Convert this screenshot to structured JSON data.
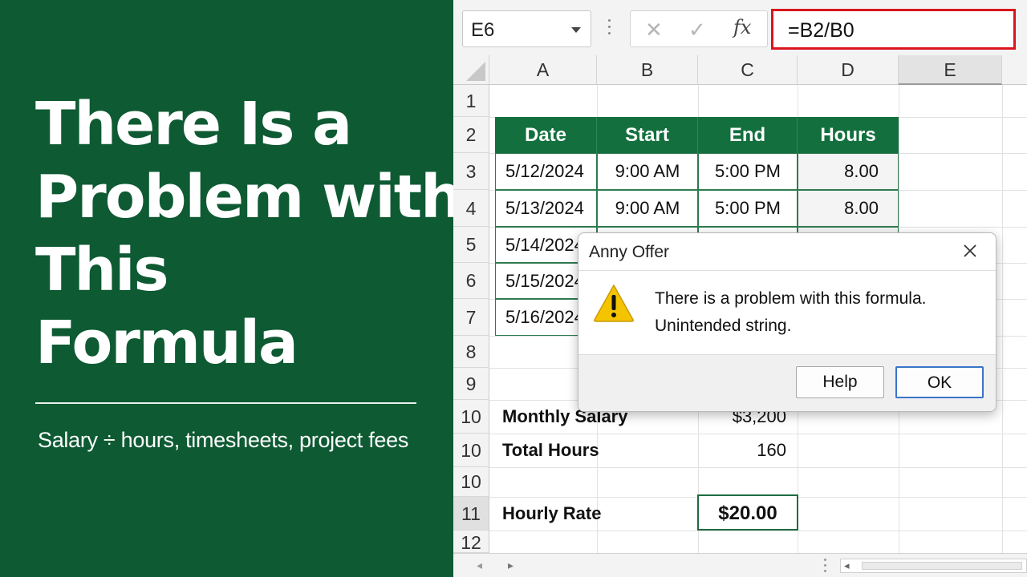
{
  "banner": {
    "title_lines": [
      "There Is a",
      "Problem with",
      "This",
      "Formula"
    ],
    "subtitle": "Salary ÷ hours, timesheets, project fees"
  },
  "formula_bar": {
    "name_box": "E6",
    "cancel_icon": "✕",
    "enter_icon": "✓",
    "fx_label": "fx",
    "formula": "=B2/B0"
  },
  "columns": [
    "A",
    "B",
    "C",
    "D",
    "E"
  ],
  "active_column": "E",
  "rows": [
    "1",
    "2",
    "3",
    "4",
    "5",
    "6",
    "7",
    "8",
    "9",
    "10",
    "10",
    "10",
    "11",
    "12"
  ],
  "active_row": "11",
  "table": {
    "headers": [
      "Date",
      "Start",
      "End",
      "Hours"
    ],
    "rows": [
      [
        "5/12/2024",
        "9:00 AM",
        "5:00 PM",
        "8.00"
      ],
      [
        "5/13/2024",
        "9:00 AM",
        "5:00 PM",
        "8.00"
      ],
      [
        "5/14/2024",
        "",
        "",
        ""
      ],
      [
        "5/15/2024",
        "",
        "",
        ""
      ],
      [
        "5/16/2024",
        "",
        "",
        ""
      ]
    ]
  },
  "summary": {
    "monthly_salary_label": "Monthly Salary",
    "monthly_salary_value": "$3,200",
    "total_hours_label": "Total Hours",
    "total_hours_value": "160",
    "hourly_rate_label": "Hourly Rate",
    "hourly_rate_value": "$20.00"
  },
  "dialog": {
    "title": "Anny Offer",
    "close_icon": "close-icon",
    "message_line1": "There is a problem with this formula.",
    "message_line2": "Unintended string.",
    "help_label": "Help",
    "ok_label": "OK"
  },
  "bottom_bar": {
    "prev_sheet": "◂",
    "next_sheet": "▸",
    "scroll_left": "◂"
  },
  "colors": {
    "banner_green": "#0e5a33",
    "header_green": "#13703e",
    "formula_highlight": "#d9161c",
    "ok_border": "#3a74c9",
    "warning_yellow": "#f5c400"
  }
}
